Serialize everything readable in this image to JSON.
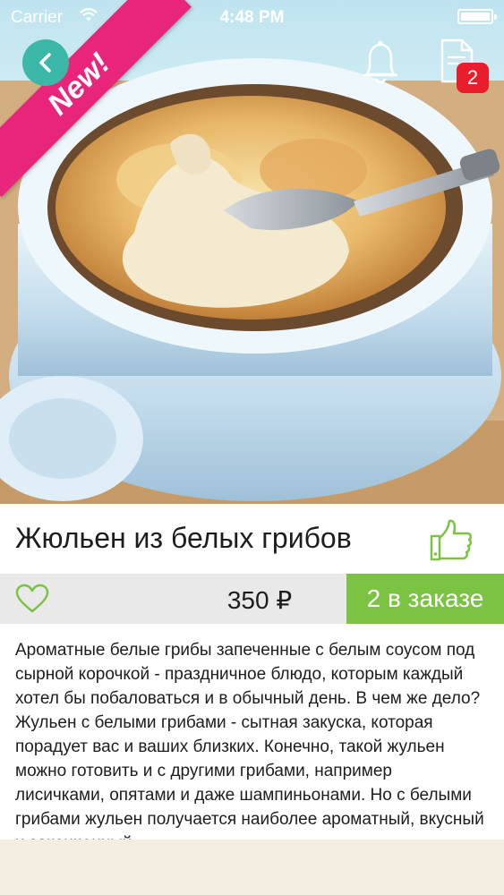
{
  "status_bar": {
    "carrier": "Carrier",
    "time": "4:48 PM",
    "wifi_icon": "wifi-icon",
    "battery_icon": "battery-icon"
  },
  "hero": {
    "ribbon_label": "New!",
    "back_icon": "chevron-left-icon",
    "bell_icon": "bell-icon",
    "orders_icon": "document-icon",
    "orders_badge": "2"
  },
  "product": {
    "title": "Жюльен из белых грибов",
    "like_icon": "thumbs-up-icon",
    "favorite_icon": "heart-icon",
    "price": "350 ₽",
    "order_label": "2 в заказе",
    "description_lines": [
      "Ароматные белые грибы запеченные с белым соусом под",
      "сырной корочкой - праздничное блюдо, которым каждый",
      "хотел бы побаловаться и в обычный день. В чем же дело?",
      "Жульен с белыми грибами - сытная закуска, которая",
      "порадует вас и ваших близких. Конечно, такой жульен",
      "можно готовить и с другими грибами, например",
      "лисичками, опятами и даже шампиньонами. Но с белыми",
      "грибами жульен получается наиболее ароматный, вкусный",
      "и законченный."
    ]
  },
  "colors": {
    "ribbon": "#e8257a",
    "back_button": "#3bb8a8",
    "badge": "#ea1d2c",
    "order_button": "#7cc344",
    "price_row": "#e9e9ea",
    "like_icon": "#7cc344"
  }
}
